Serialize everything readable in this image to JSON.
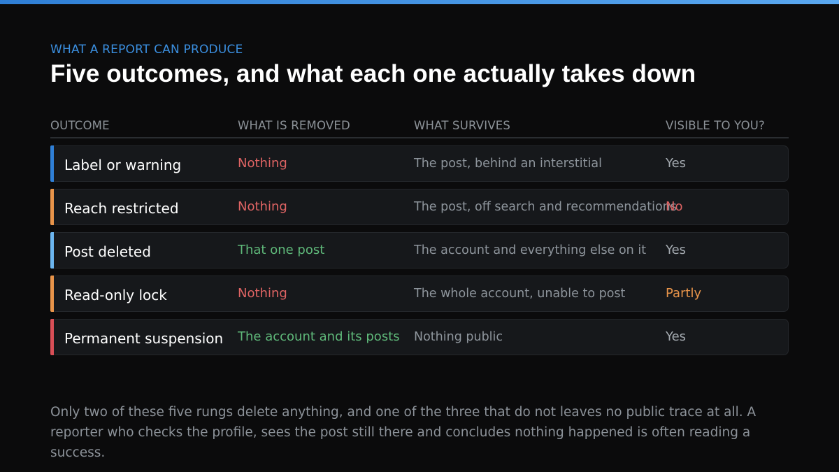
{
  "eyebrow": "WHAT A REPORT CAN PRODUCE",
  "title": "Five outcomes, and what each one actually takes down",
  "columns": [
    "OUTCOME",
    "WHAT IS REMOVED",
    "WHAT SURVIVES",
    "VISIBLE TO YOU?"
  ],
  "rows": [
    {
      "outcome": "Label or warning",
      "removed": "Nothing",
      "survives": "The post, behind an interstitial",
      "visible": "Yes"
    },
    {
      "outcome": "Reach restricted",
      "removed": "Nothing",
      "survives": "The post, off search and recommendations",
      "visible": "No"
    },
    {
      "outcome": "Post deleted",
      "removed": "That one post",
      "survives": "The account and everything else on it",
      "visible": "Yes"
    },
    {
      "outcome": "Read-only lock",
      "removed": "Nothing",
      "survives": "The whole account, unable to post",
      "visible": "Partly"
    },
    {
      "outcome": "Permanent suspension",
      "removed": "The account and its posts",
      "survives": "Nothing public",
      "visible": "Yes"
    }
  ],
  "footnote": "Only two of these five rungs delete anything, and one of the three that do not leaves no public trace at all. A reporter who checks the profile, sees the post still there and concludes nothing happened is often reading a success.",
  "colors": {
    "accent_blue": "#2f7fd6",
    "accent_orange": "#e8944a",
    "accent_light_blue": "#6cb6f0",
    "accent_red": "#d94f57",
    "text_red": "#e06464",
    "text_green": "#5fb97a",
    "text_orange": "#e8944a"
  }
}
